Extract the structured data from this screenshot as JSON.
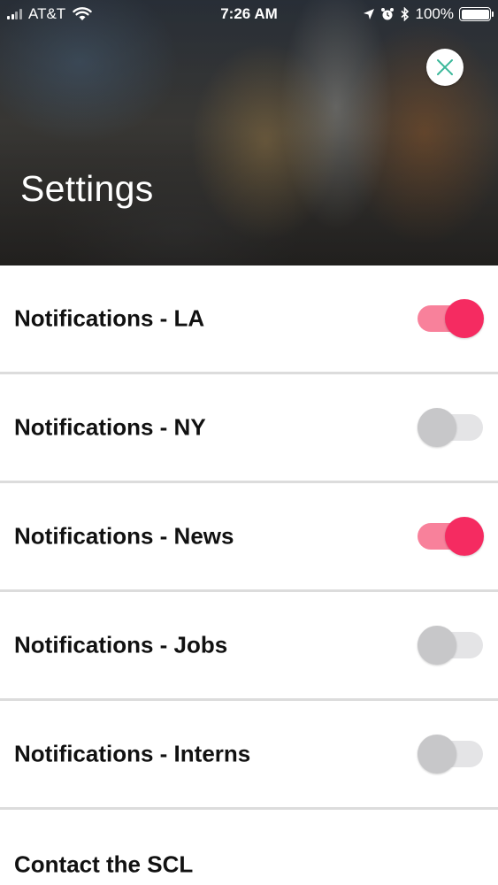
{
  "status_bar": {
    "carrier": "AT&T",
    "time": "7:26 AM",
    "battery_percent": "100%",
    "icons": [
      "signal-icon",
      "wifi-icon",
      "location-icon",
      "alarm-icon",
      "bluetooth-icon",
      "battery-icon"
    ]
  },
  "header": {
    "title": "Settings",
    "close_icon": "close-icon"
  },
  "settings": [
    {
      "label": "Notifications - LA",
      "enabled": true
    },
    {
      "label": "Notifications - NY",
      "enabled": false
    },
    {
      "label": "Notifications - News",
      "enabled": true
    },
    {
      "label": "Notifications - Jobs",
      "enabled": false
    },
    {
      "label": "Notifications - Interns",
      "enabled": false
    }
  ],
  "contact": {
    "label": "Contact the SCL"
  },
  "colors": {
    "toggle_on_knob": "#f52b61",
    "toggle_on_track": "#f8819b",
    "toggle_off_knob": "#c7c7c9",
    "toggle_off_track": "#e4e4e6",
    "close_icon": "#3bb89a"
  }
}
